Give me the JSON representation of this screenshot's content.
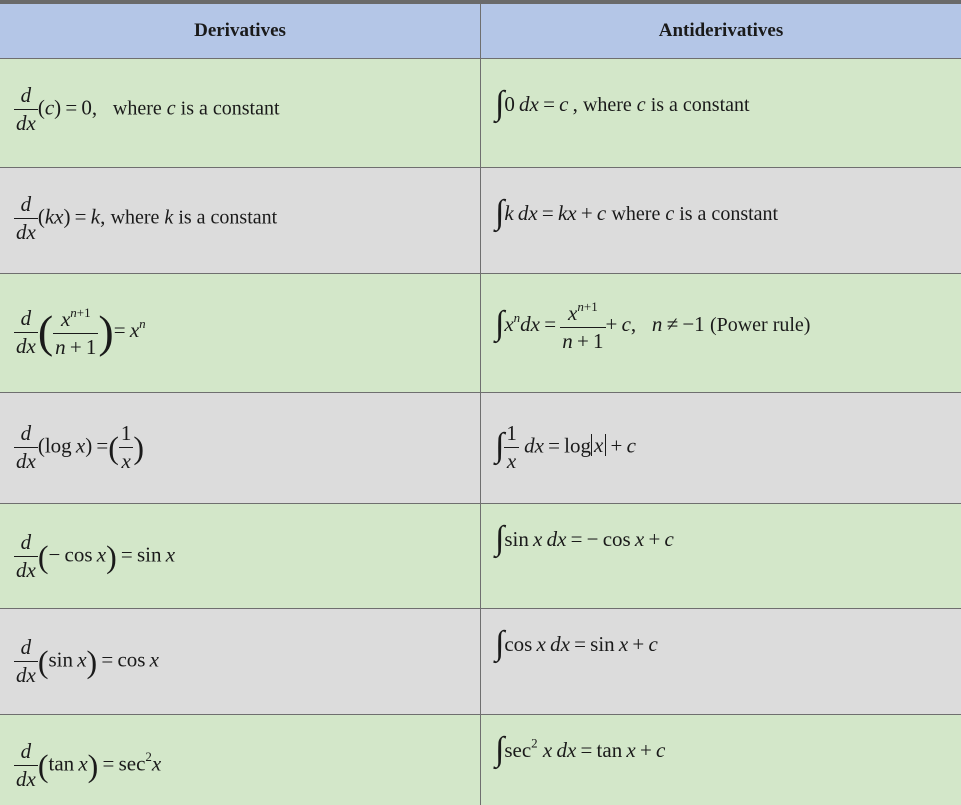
{
  "header": {
    "col_left": "Derivatives",
    "col_right": "Antiderivatives"
  },
  "rows": [
    {
      "derivative": "d/dx (c) = 0, where c is a constant",
      "antiderivative": "∫0 dx = c, where c is a constant"
    },
    {
      "derivative": "d/dx (kx) = k, where k is a constant",
      "antiderivative": "∫k dx = kx + c where c is a constant"
    },
    {
      "derivative": "d/dx (x^(n+1)/(n+1)) = x^n",
      "antiderivative": "∫x^n dx = x^(n+1)/(n+1) + c, n ≠ −1 (Power rule)"
    },
    {
      "derivative": "d/dx (log x) = (1/x)",
      "antiderivative": "∫1/x dx = log|x| + c"
    },
    {
      "derivative": "d/dx (−cos x) = sin x",
      "antiderivative": "∫sin x dx = −cos x + c"
    },
    {
      "derivative": "d/dx (sin x) = cos x",
      "antiderivative": "∫cos x dx = sin x + c"
    },
    {
      "derivative": "d/dx (tan x) = sec²x",
      "antiderivative": "∫sec² x dx = tan x + c"
    }
  ],
  "labels": {
    "constant_clause": "where c is a constant",
    "constant_clause_k": "where k is a constant",
    "power_rule_note": "(Power rule)"
  },
  "colors": {
    "header_bg": "#b4c6e7",
    "green_row": "#d3e7c9",
    "gray_row": "#dcdcdc",
    "border": "#6f6f6f"
  }
}
